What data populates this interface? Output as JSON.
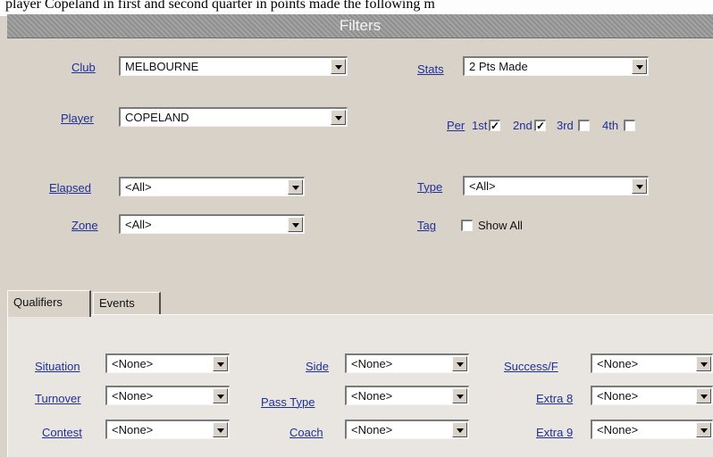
{
  "caption": "player Copeland in first and second quarter in points made the following m",
  "header": {
    "title": "Filters"
  },
  "filters": {
    "club": {
      "label": "Club",
      "value": "MELBOURNE"
    },
    "player": {
      "label": "Player",
      "value": "COPELAND"
    },
    "elapsed": {
      "label": "Elapsed",
      "value": "<All>"
    },
    "zone": {
      "label": "Zone",
      "value": "<All>"
    },
    "stats": {
      "label": "Stats",
      "value": "2 Pts Made"
    },
    "per": {
      "label": "Per",
      "periods": [
        {
          "label": "1st",
          "checked": true
        },
        {
          "label": "2nd",
          "checked": true
        },
        {
          "label": "3rd",
          "checked": false
        },
        {
          "label": "4th",
          "checked": false
        }
      ]
    },
    "type": {
      "label": "Type",
      "value": "<All>"
    },
    "tag": {
      "label": "Tag",
      "option": "Show All",
      "checked": false
    }
  },
  "tabs": [
    {
      "label": "Qualifiers",
      "active": true
    },
    {
      "label": "Events",
      "active": false
    }
  ],
  "qualifiers": {
    "situation": {
      "label": "Situation",
      "value": "<None>"
    },
    "turnover": {
      "label": "Turnover",
      "value": "<None>"
    },
    "contest": {
      "label": "Contest",
      "value": "<None>"
    },
    "side": {
      "label": "Side",
      "value": "<None>"
    },
    "pass_type": {
      "label": "Pass Type",
      "value": "<None>"
    },
    "coach": {
      "label": "Coach",
      "value": "<None>"
    },
    "success": {
      "label": "Success/F",
      "value": "<None>"
    },
    "extra8": {
      "label": "Extra 8",
      "value": "<None>"
    },
    "extra9": {
      "label": "Extra 9",
      "value": "<None>"
    }
  },
  "check_mark": "✓"
}
